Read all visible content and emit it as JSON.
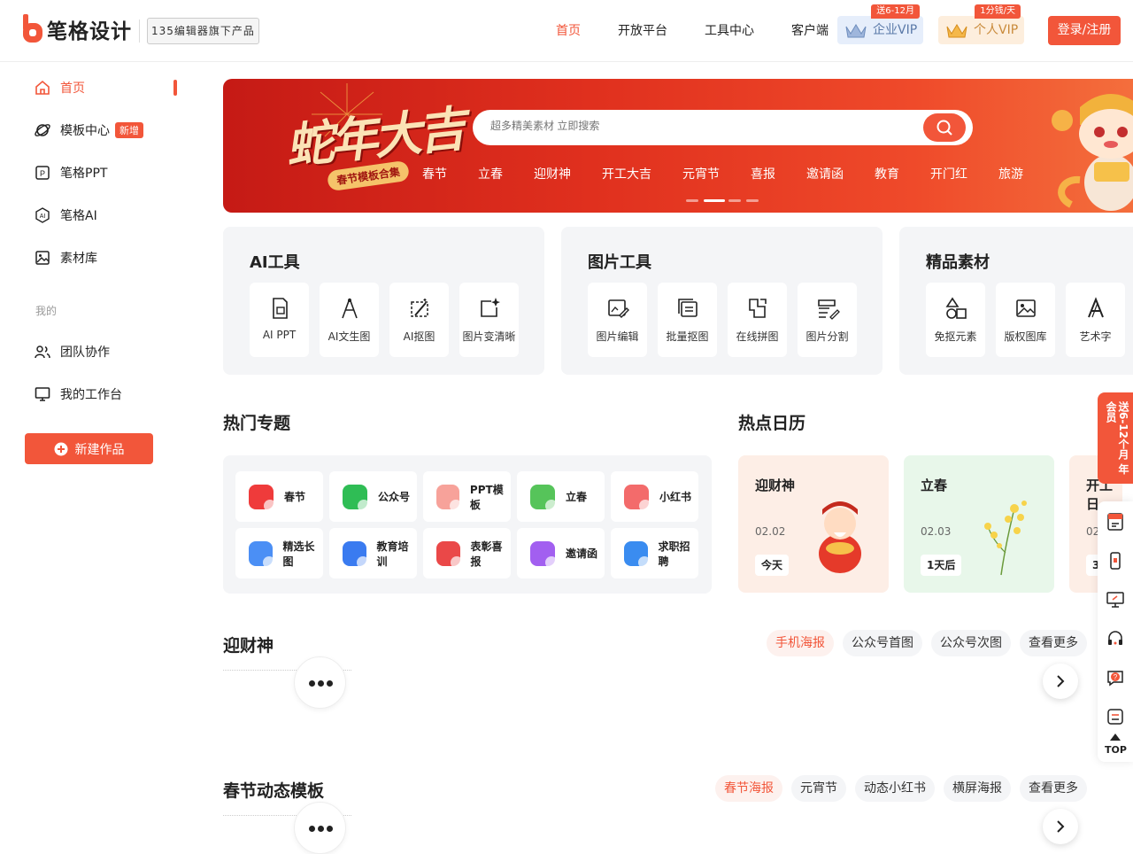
{
  "header": {
    "logo_text": "笔格设计",
    "sub_badge": "135编辑器旗下产品",
    "nav": [
      "首页",
      "开放平台",
      "工具中心",
      "客户端"
    ],
    "enterprise_vip": {
      "label": "企业VIP",
      "tag": "送6-12月"
    },
    "personal_vip": {
      "label": "个人VIP",
      "tag": "1分钱/天"
    },
    "login": "登录/注册"
  },
  "sidebar": {
    "items": [
      {
        "label": "首页",
        "icon": "home-icon"
      },
      {
        "label": "模板中心",
        "icon": "planet-icon",
        "badge": "新增"
      },
      {
        "label": "笔格PPT",
        "icon": "ppt-icon"
      },
      {
        "label": "笔格AI",
        "icon": "ai-icon"
      },
      {
        "label": "素材库",
        "icon": "image-icon"
      }
    ],
    "mine_label": "我的",
    "mine_items": [
      {
        "label": "团队协作",
        "icon": "team-icon"
      },
      {
        "label": "我的工作台",
        "icon": "monitor-icon"
      }
    ],
    "new_work": "新建作品"
  },
  "banner": {
    "title": "蛇年大吉",
    "ribbon": "春节模板合集",
    "search_placeholder": "超多精美素材 立即搜索",
    "keywords": [
      "春节",
      "立春",
      "迎财神",
      "开工大吉",
      "元宵节",
      "喜报",
      "邀请函",
      "教育",
      "开门红",
      "旅游"
    ]
  },
  "tools": {
    "ai": {
      "title": "AI工具",
      "items": [
        "AI PPT",
        "AI文生图",
        "AI抠图",
        "图片变清晰"
      ]
    },
    "image": {
      "title": "图片工具",
      "items": [
        "图片编辑",
        "批量抠图",
        "在线拼图",
        "图片分割"
      ]
    },
    "material": {
      "title": "精品素材",
      "items": [
        "免抠元素",
        "版权图库",
        "艺术字"
      ]
    }
  },
  "hot_topics": {
    "title": "热门专题",
    "items": [
      "春节",
      "公众号",
      "PPT模板",
      "立春",
      "小红书",
      "精选长图",
      "教育培训",
      "表彰喜报",
      "邀请函",
      "求职招聘"
    ]
  },
  "calendar": {
    "title": "热点日历",
    "cards": [
      {
        "title": "迎财神",
        "date": "02.02",
        "badge": "今天"
      },
      {
        "title": "立春",
        "date": "02.03",
        "badge": "1天后"
      },
      {
        "title": "开工日",
        "date": "02",
        "badge": "3"
      }
    ]
  },
  "section1": {
    "title": "迎财神",
    "tabs": [
      "手机海报",
      "公众号首图",
      "公众号次图",
      "查看更多"
    ]
  },
  "section2": {
    "title": "春节动态模板",
    "tabs": [
      "春节海报",
      "元宵节",
      "动态小红书",
      "横屏海报",
      "查看更多"
    ]
  },
  "float": {
    "promo": "送6-12个月 年会员",
    "top": "TOP"
  },
  "colors": {
    "accent": "#f2563a"
  }
}
